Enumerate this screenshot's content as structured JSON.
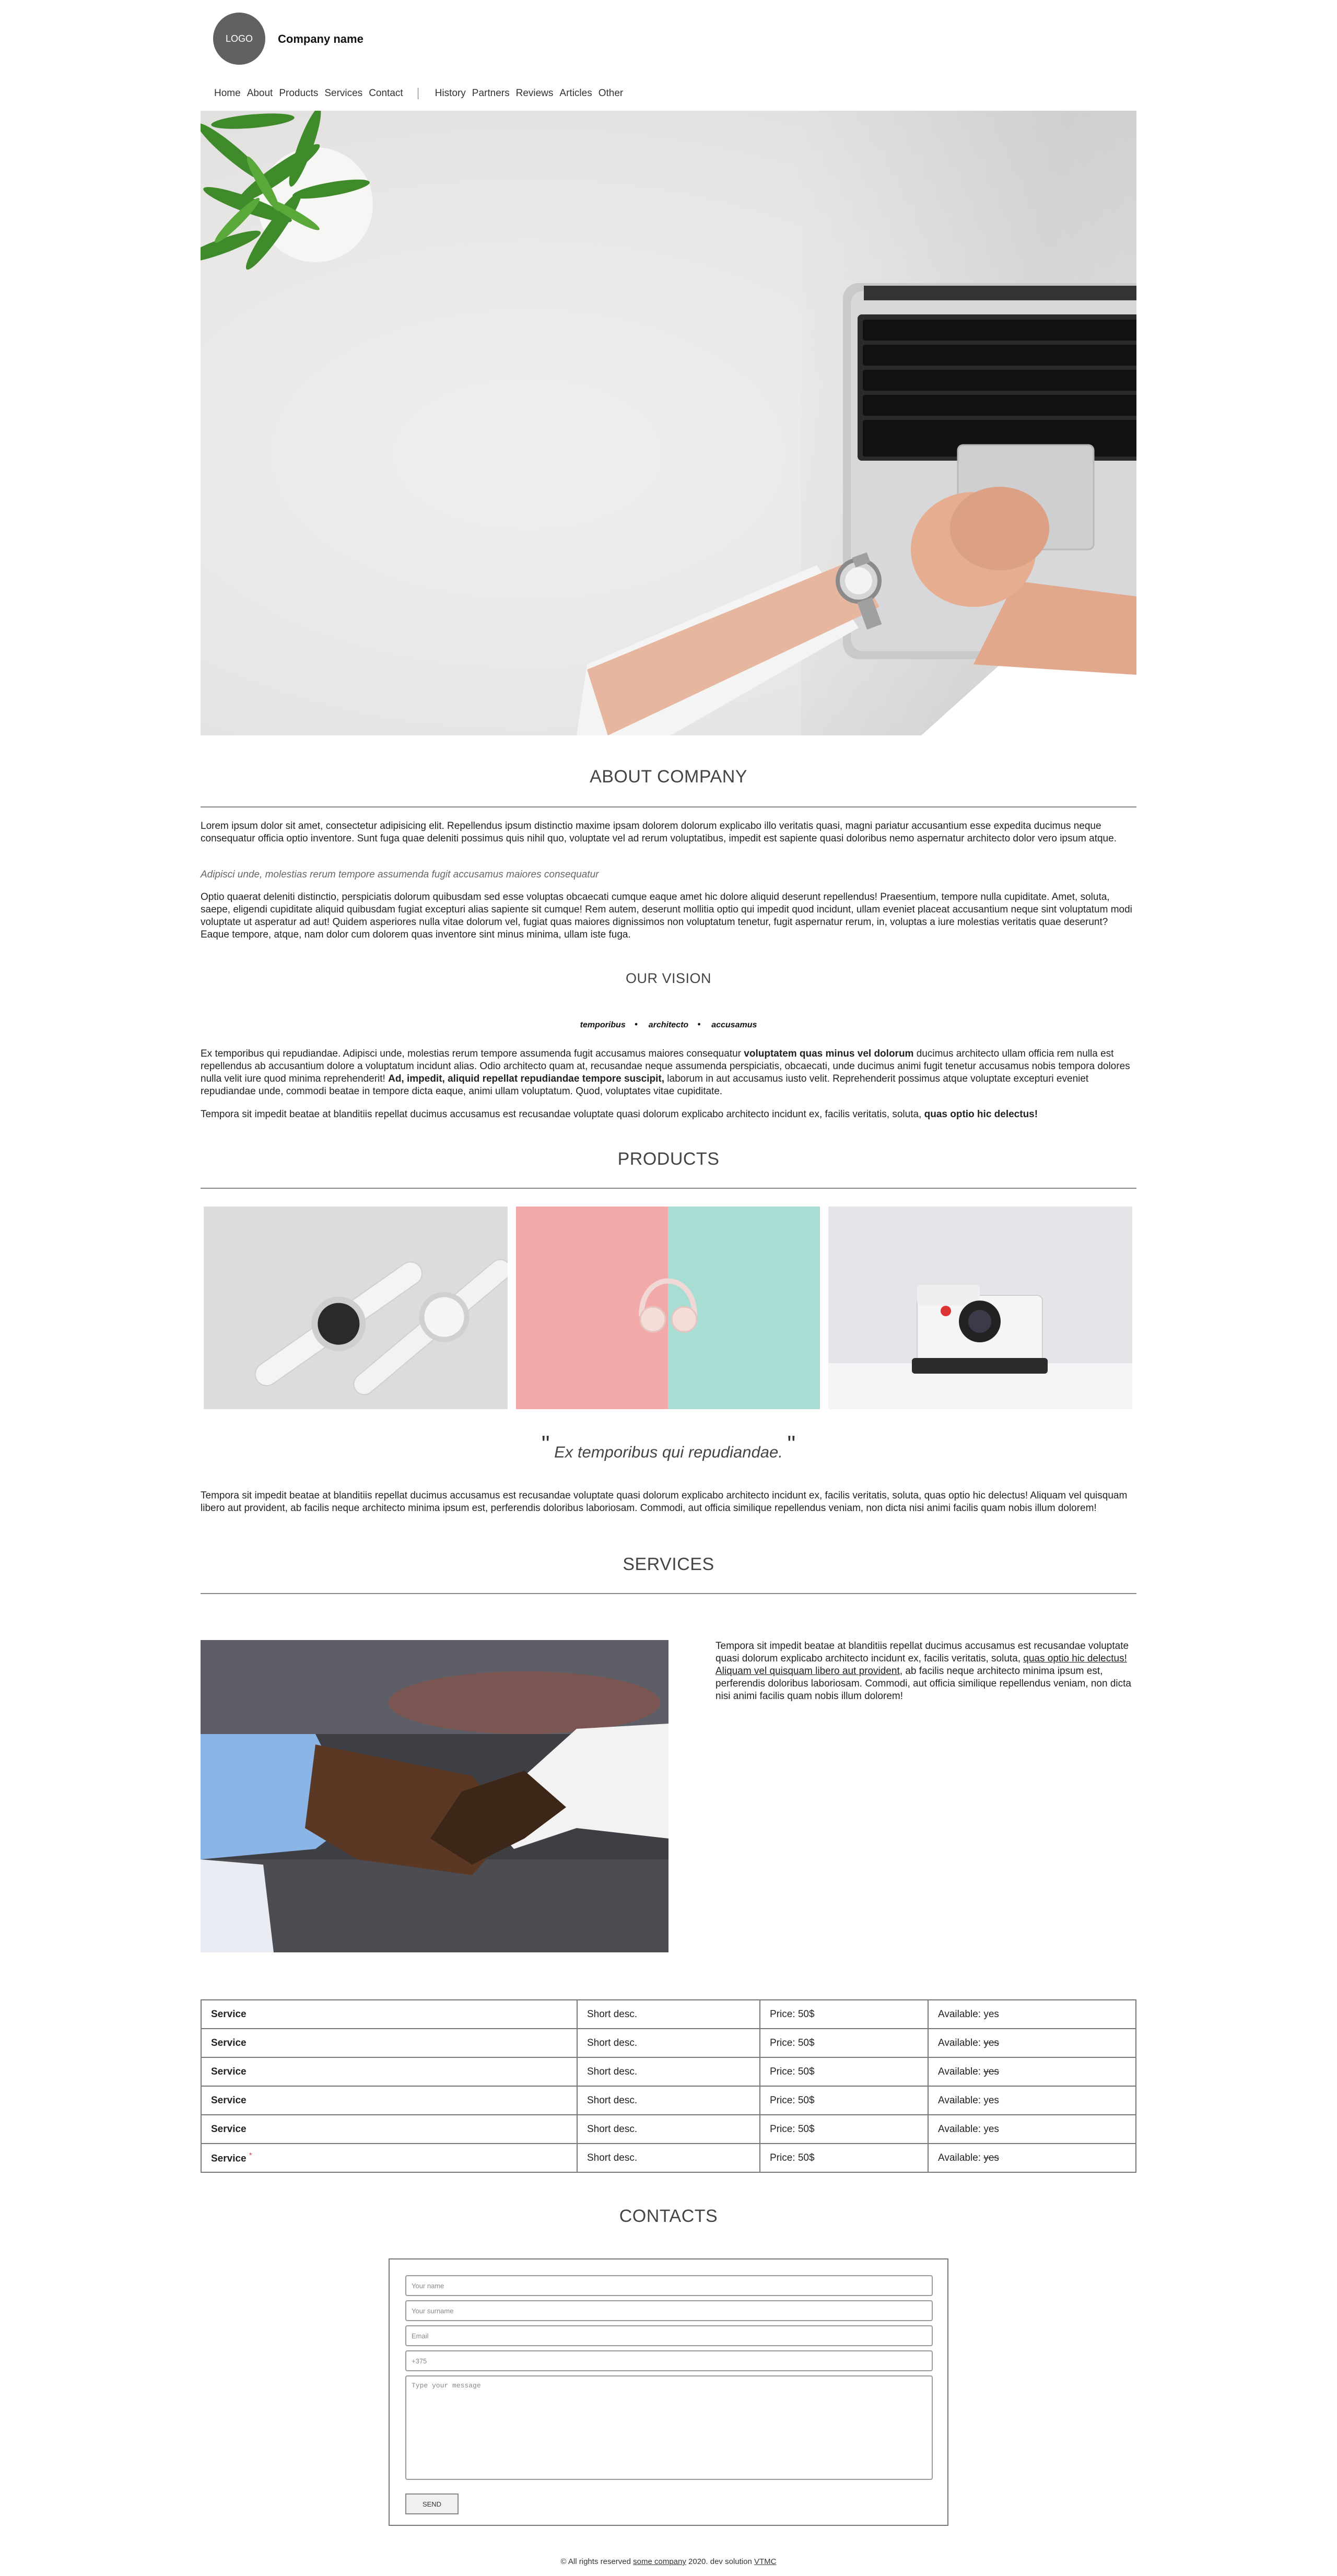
{
  "header": {
    "logo": "LOGO",
    "company_name": "Company name"
  },
  "nav": {
    "primary": [
      "Home",
      "About",
      "Products",
      "Services",
      "Contact"
    ],
    "secondary": [
      "History",
      "Partners",
      "Reviews",
      "Articles",
      "Other"
    ]
  },
  "about": {
    "title": "ABOUT COMPANY",
    "paragraph1": "Lorem ipsum dolor sit amet, consectetur adipisicing elit. Repellendus ipsum distinctio maxime ipsam dolorem dolorum explicabo illo veritatis quasi, magni pariatur accusantium esse expedita ducimus neque consequatur officia optio inventore. Sunt fuga quae deleniti possimus quis nihil quo, voluptate vel ad rerum voluptatibus, impedit est sapiente quasi doloribus nemo aspernatur architecto dolor vero ipsum atque.",
    "italic": "Adipisci unde, molestias rerum tempore assumenda fugit accusamus maiores consequatur",
    "paragraph2": "Optio quaerat deleniti distinctio, perspiciatis dolorum quibusdam sed esse voluptas obcaecati cumque eaque amet hic dolore aliquid deserunt repellendus! Praesentium, tempore nulla cupiditate. Amet, soluta, saepe, eligendi cupiditate aliquid quibusdam fugiat excepturi alias sapiente sit cumque! Rem autem, deserunt mollitia optio qui impedit quod incidunt, ullam eveniet placeat accusantium neque sint voluptatum modi voluptate ut asperatur ad aut! Quidem asperiores nulla vitae dolorum vel, fugiat quas maiores dignissimos non voluptatum tenetur, fugit aspernatur rerum, in, voluptas a iure molestias veritatis quae deserunt? Eaque tempore, atque, nam dolor cum dolorem quas inventore sint minus minima, ullam iste fuga."
  },
  "vision": {
    "title": "OUR VISION",
    "list": [
      "temporibus",
      "architecto",
      "accusamus"
    ],
    "p1_a": "Ex temporibus qui repudiandae. Adipisci unde, molestias rerum tempore assumenda fugit accusamus maiores consequatur ",
    "p1_b": "voluptatem quas minus vel dolorum",
    "p1_c": " ducimus architecto ullam officia rem nulla est repellendus ab accusantium dolore a voluptatum incidunt alias. Odio architecto quam at, recusandae neque assumenda perspiciatis, obcaecati, unde ducimus animi fugit tenetur accusamus nobis tempora dolores nulla velit iure quod minima reprehenderit! ",
    "p1_d": "Ad, impedit, aliquid repellat repudiandae tempore suscipit,",
    "p1_e": " laborum in aut accusamus iusto velit. Reprehenderit possimus atque voluptate excepturi eveniet repudiandae unde, commodi beatae in tempore dicta eaque, animi ullam voluptatum. Quod, voluptates vitae cupiditate.",
    "p2_a": "Tempora sit impedit beatae at blanditiis repellat ducimus accusamus est recusandae voluptate quasi dolorum explicabo architecto incidunt ex, facilis veritatis, soluta, ",
    "p2_b": "quas optio hic delectus!"
  },
  "products": {
    "title": "PRODUCTS",
    "quote": "Ex temporibus qui repudiandae.",
    "quote_open": "\"",
    "quote_close": "\"",
    "text": "Tempora sit impedit beatae at blanditiis repellat ducimus accusamus est recusandae voluptate quasi dolorum explicabo architecto incidunt ex, facilis veritatis, soluta, quas optio hic delectus! Aliquam vel quisquam libero aut provident, ab facilis neque architecto minima ipsum est, perferendis doloribus laboriosam. Commodi, aut officia similique repellendus veniam, non dicta nisi animi facilis quam nobis illum dolorem!"
  },
  "services": {
    "title": "SERVICES",
    "text_a": "Tempora sit impedit beatae at blanditiis repellat ducimus accusamus est recusandae voluptate quasi dolorum explicabo architecto incidunt ex, facilis veritatis, soluta, ",
    "text_link": "quas optio hic delectus! Aliquam vel quisquam libero aut provident",
    "text_b": ", ab facilis neque architecto minima ipsum est, perferendis doloribus laboriosam. Commodi, aut officia similique repellendus veniam, non dicta nisi animi facilis quam nobis illum dolorem!",
    "rows": [
      {
        "name": "Service",
        "desc": "Short desc.",
        "price": "Price: 50$",
        "avail_label": "Available: ",
        "avail": "yes",
        "struck": false,
        "mark": ""
      },
      {
        "name": "Service",
        "desc": "Short desc.",
        "price": "Price: 50$",
        "avail_label": "Available: ",
        "avail": "yes",
        "struck": true,
        "mark": ""
      },
      {
        "name": "Service",
        "desc": "Short desc.",
        "price": "Price: 50$",
        "avail_label": "Available: ",
        "avail": "yes",
        "struck": true,
        "mark": ""
      },
      {
        "name": "Service",
        "desc": "Short desc.",
        "price": "Price: 50$",
        "avail_label": "Available: ",
        "avail": "yes",
        "struck": false,
        "mark": ""
      },
      {
        "name": "Service",
        "desc": "Short desc.",
        "price": "Price: 50$",
        "avail_label": "Available: ",
        "avail": "yes",
        "struck": false,
        "mark": ""
      },
      {
        "name": "Service",
        "desc": "Short desc.",
        "price": "Price: 50$",
        "avail_label": "Available: ",
        "avail": "yes",
        "struck": true,
        "mark": "*"
      }
    ]
  },
  "contacts": {
    "title": "CONTACTS",
    "name_placeholder": "Your name",
    "surname_placeholder": "Your surname",
    "email_placeholder": "Email",
    "phone_placeholder": "+375",
    "message_placeholder": "Type your message",
    "send_label": "SEND"
  },
  "footer": {
    "prefix": "© All rights reserved ",
    "link1": "some company",
    "middle": " 2020. dev solution ",
    "link2": "VTMC"
  }
}
